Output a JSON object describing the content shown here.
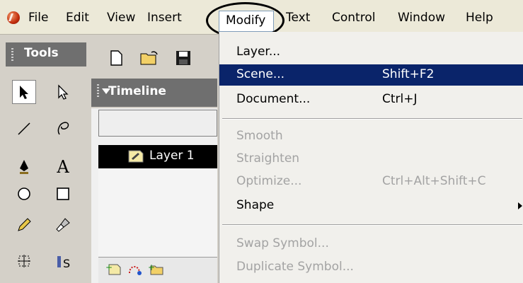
{
  "menubar": {
    "items": [
      "File",
      "Edit",
      "View",
      "Insert",
      "Modify",
      "Text",
      "Control",
      "Window",
      "Help"
    ]
  },
  "tools": {
    "title": "Tools",
    "icons": [
      "arrow-tool",
      "subselect-tool",
      "line-tool",
      "lasso-tool",
      "pen-tool",
      "text-tool",
      "oval-tool",
      "rectangle-tool",
      "pencil-tool",
      "brush-tool",
      "free-transform-tool",
      "fill-transform-tool"
    ],
    "text_tool_glyph": "A"
  },
  "timeline": {
    "title": "Timeline",
    "layer_name": "Layer 1"
  },
  "modify_menu": {
    "items": [
      {
        "label": "Layer...",
        "shortcut": "",
        "state": "enabled"
      },
      {
        "label": "Scene...",
        "shortcut": "Shift+F2",
        "state": "selected"
      },
      {
        "label": "Document...",
        "shortcut": "Ctrl+J",
        "state": "enabled"
      },
      {
        "label": "Smooth",
        "shortcut": "",
        "state": "disabled"
      },
      {
        "label": "Straighten",
        "shortcut": "",
        "state": "disabled"
      },
      {
        "label": "Optimize...",
        "shortcut": "Ctrl+Alt+Shift+C",
        "state": "disabled"
      },
      {
        "label": "Shape",
        "shortcut": "",
        "state": "enabled",
        "submenu": true
      },
      {
        "label": "Swap Symbol...",
        "shortcut": "",
        "state": "disabled"
      },
      {
        "label": "Duplicate Symbol...",
        "shortcut": "",
        "state": "disabled"
      }
    ]
  },
  "colors": {
    "selection": "#0a246a",
    "disabled": "#a3a3a3",
    "panel_header": "#6f6f6f"
  }
}
